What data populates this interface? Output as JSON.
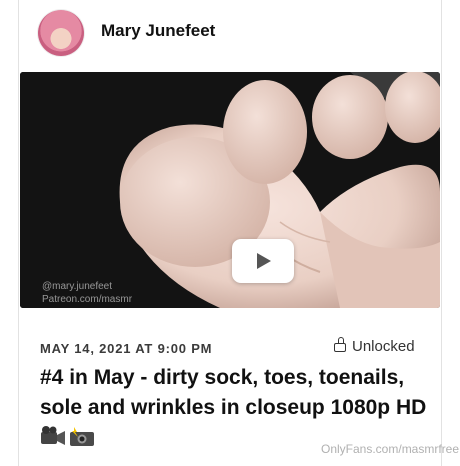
{
  "post": {
    "author": "Mary Junefeet",
    "video": {
      "watermark_line1": "@mary.junefeet",
      "watermark_line2": "Patreon.com/masmr"
    },
    "date": "MAY 14, 2021 AT 9:00 PM",
    "status": "Unlocked",
    "title": "#4 in May - dirty sock, toes, toenails, sole and wrinkles in closeup 1080p HD"
  },
  "site_watermark": "OnlyFans.com/masmrfree",
  "icons": {
    "lock": "open-lock-icon",
    "play": "play-icon",
    "emoji": [
      "video-camera-icon",
      "camera-flash-icon"
    ]
  }
}
